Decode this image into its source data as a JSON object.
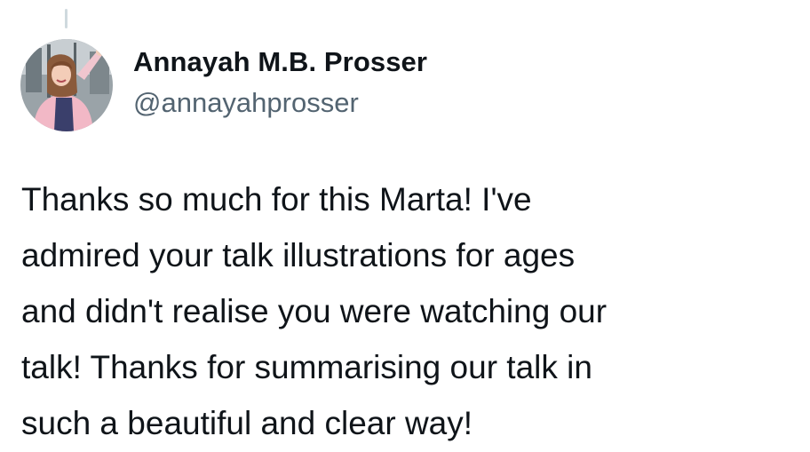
{
  "author": {
    "display_name": "Annayah M.B. Prosser",
    "handle": "@annayahprosser",
    "avatar_icon": "profile-photo-icon"
  },
  "tweet": {
    "lines": [
      "Thanks so much for this Marta! I've",
      "admired your talk illustrations for ages",
      "and didn't realise you were watching our",
      "talk! Thanks for summarising our talk in",
      "such a beautiful and clear way!"
    ]
  },
  "colors": {
    "text": "#0f1419",
    "secondary_text": "#536471",
    "thread_line": "#cfd9de",
    "background": "#ffffff"
  }
}
